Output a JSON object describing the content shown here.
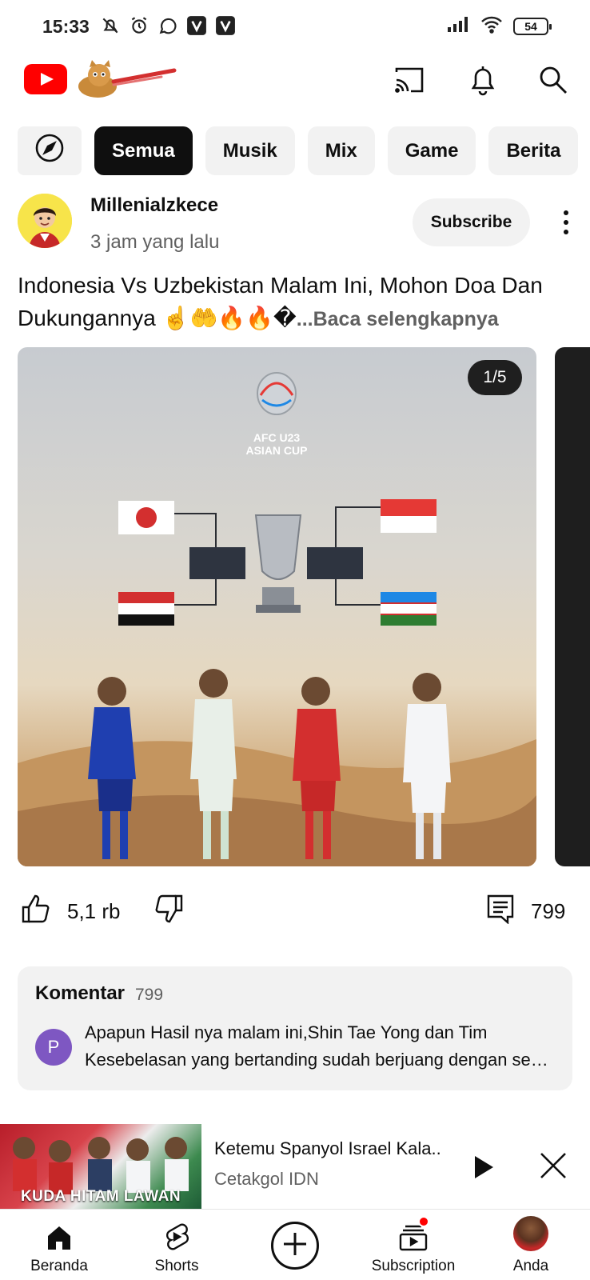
{
  "status_bar": {
    "time": "15:33",
    "battery": "54",
    "left_icons": [
      "mute-icon",
      "alarm-icon",
      "whatsapp-icon",
      "v-app-icon",
      "v-app-icon"
    ],
    "right_icons": [
      "signal-icon",
      "wifi-icon",
      "battery-icon"
    ]
  },
  "app_bar": {
    "logo": "youtube-logo",
    "icons": [
      "cast-icon",
      "bell-icon",
      "search-icon"
    ]
  },
  "chips": {
    "explore_icon": "compass-icon",
    "items": [
      "Semua",
      "Musik",
      "Mix",
      "Game",
      "Berita"
    ],
    "active": "Semua"
  },
  "post": {
    "channel": "Millenialzkece",
    "time": "3 jam yang lalu",
    "subscribe": "Subscribe",
    "text": "Indonesia Vs Uzbekistan Malam Ini, Mohon Doa Dan Dukungannya ☝️🤲🔥🔥�",
    "read_more": "...Baca selengkapnya",
    "image_counter": "1/5",
    "image_logo_line1": "AFC U23",
    "image_logo_line2": "ASIAN CUP",
    "likes": "5,1 rb",
    "comments_count": "799"
  },
  "comments": {
    "title": "Komentar",
    "count": "799",
    "top_comment_avatar": "P",
    "top_comment_text": "Apapun Hasil nya malam ini,Shin Tae Yong dan Tim Kesebelasan yang bertanding sudah berjuang dengan se…"
  },
  "mini_player": {
    "thumb_text": "KUDA HITAM LAWAN",
    "title": "Ketemu Spanyol Israel Kala..",
    "channel": "Cetakgol IDN"
  },
  "bottom_nav": {
    "items": [
      "Beranda",
      "Shorts",
      "Subscription",
      "Anda"
    ],
    "active": "Beranda"
  },
  "colors": {
    "accent": "#ff0000",
    "chip_active_bg": "#0f0f0f",
    "chip_bg": "#f2f2f2",
    "secondary_text": "#606060"
  }
}
